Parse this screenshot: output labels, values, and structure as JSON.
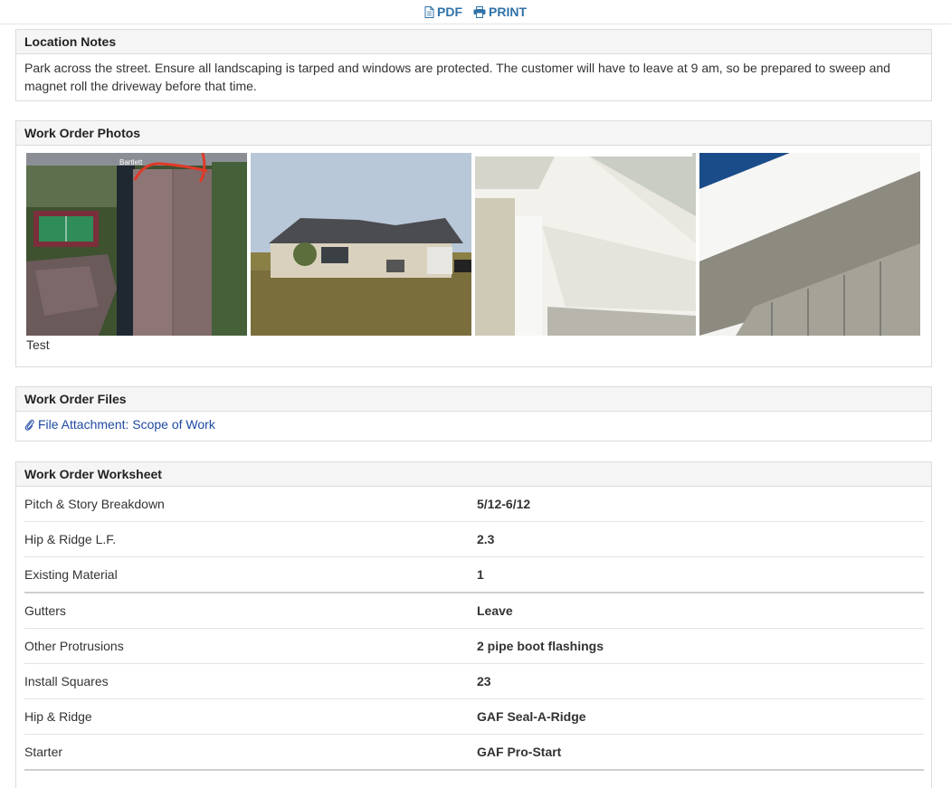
{
  "toolbar": {
    "pdf_label": "PDF",
    "print_label": "PRINT",
    "link_color": "#2f72a8"
  },
  "location_notes": {
    "title": "Location Notes",
    "text": "Park across the street. Ensure all landscaping is tarped and windows are protected. The customer will have to leave at 9 am, so be prepared to sweep and magnet roll the driveway before that time."
  },
  "photos": {
    "title": "Work Order Photos",
    "items": [
      {
        "name": "aerial-roof-photo",
        "map_label": "Bartlett",
        "caption": "Test"
      },
      {
        "name": "house-front-photo"
      },
      {
        "name": "soffit-corner-photo"
      },
      {
        "name": "soffit-vent-closeup-photo"
      }
    ]
  },
  "files": {
    "title": "Work Order Files",
    "link": "File Attachment: Scope of Work",
    "icon": "paperclip-icon"
  },
  "worksheet": {
    "title": "Work Order Worksheet",
    "rows": [
      {
        "label": "Pitch & Story Breakdown",
        "value": "5/12-6/12"
      },
      {
        "label": "Hip & Ridge L.F.",
        "value": "2.3"
      },
      {
        "label": "Existing Material",
        "value": "1"
      },
      {
        "label": "Gutters",
        "value": "Leave"
      },
      {
        "label": "Other Protrusions",
        "value": "2 pipe boot flashings"
      },
      {
        "label": "Install Squares",
        "value": "23"
      },
      {
        "label": "Hip & Ridge",
        "value": "GAF Seal-A-Ridge"
      },
      {
        "label": "Starter",
        "value": "GAF Pro-Start"
      }
    ]
  }
}
